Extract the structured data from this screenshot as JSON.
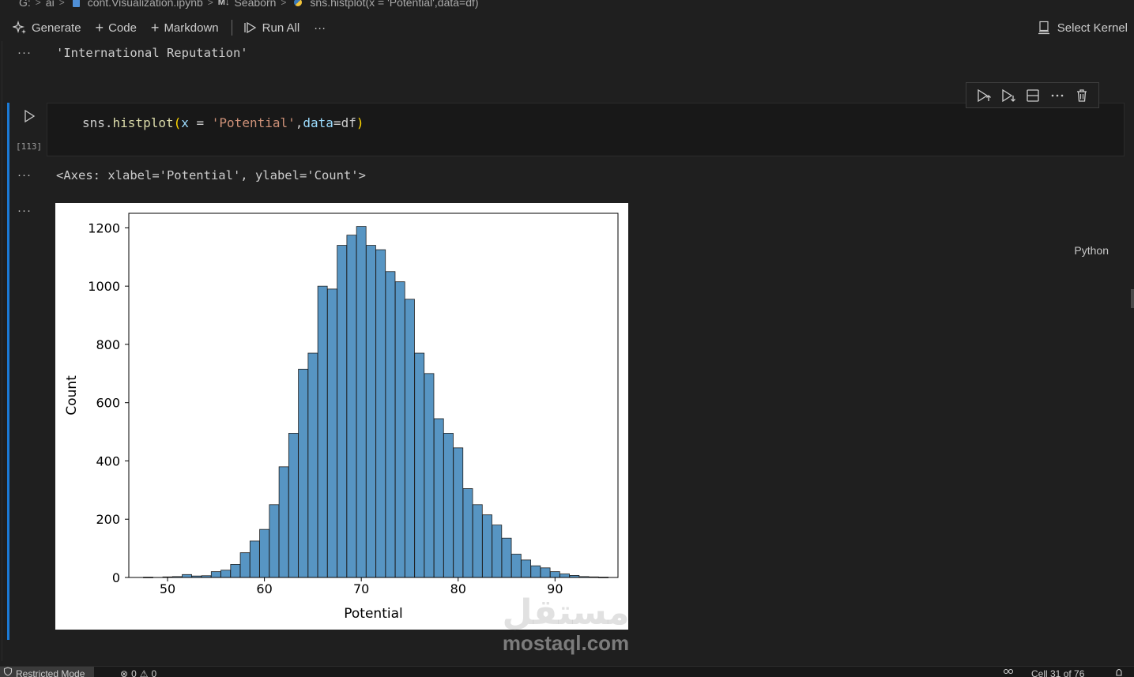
{
  "breadcrumb": {
    "items": [
      "G:",
      "ai",
      "cont.Visualization.ipynb",
      "M↓",
      "Seaborn",
      "sns.histplot(x = 'Potential',data=df)"
    ]
  },
  "toolbar": {
    "generate_label": "Generate",
    "code_label": "Code",
    "markdown_label": "Markdown",
    "run_all_label": "Run All",
    "more_label": "···",
    "kernel_label": "Select Kernel"
  },
  "outputs": {
    "dots": "···",
    "prev_output": "'International Reputation'",
    "axes_repr": "<Axes: xlabel='Potential', ylabel='Count'>"
  },
  "cell": {
    "code_tokens": [
      {
        "text": "sns.",
        "cls": "t-plain"
      },
      {
        "text": "histplot",
        "cls": "t-fn"
      },
      {
        "text": "(",
        "cls": "t-paren"
      },
      {
        "text": "x",
        "cls": "t-var"
      },
      {
        "text": " = ",
        "cls": "t-op"
      },
      {
        "text": "'Potential'",
        "cls": "t-str"
      },
      {
        "text": ",",
        "cls": "t-plain"
      },
      {
        "text": "data",
        "cls": "t-var"
      },
      {
        "text": "=",
        "cls": "t-op"
      },
      {
        "text": "df",
        "cls": "t-plain"
      },
      {
        "text": ")",
        "cls": "t-paren"
      }
    ],
    "execution_count": "[113]",
    "language": "Python"
  },
  "chart_data": {
    "type": "bar",
    "title": "",
    "xlabel": "Potential",
    "ylabel": "Count",
    "xlim": [
      46,
      96.5
    ],
    "ylim": [
      0,
      1250
    ],
    "xticks": [
      50,
      60,
      70,
      80,
      90
    ],
    "yticks": [
      0,
      200,
      400,
      600,
      800,
      1000,
      1200
    ],
    "bar_color": "#4e8fc0",
    "bin_width": 0.98,
    "bins": [
      {
        "x": 48.0,
        "count": 1
      },
      {
        "x": 49.0,
        "count": 0
      },
      {
        "x": 50.0,
        "count": 2
      },
      {
        "x": 51.0,
        "count": 3
      },
      {
        "x": 52.0,
        "count": 10
      },
      {
        "x": 53.0,
        "count": 5
      },
      {
        "x": 54.0,
        "count": 6
      },
      {
        "x": 55.0,
        "count": 20
      },
      {
        "x": 56.0,
        "count": 25
      },
      {
        "x": 57.0,
        "count": 45
      },
      {
        "x": 58.0,
        "count": 85
      },
      {
        "x": 59.0,
        "count": 125
      },
      {
        "x": 60.0,
        "count": 165
      },
      {
        "x": 61.0,
        "count": 250
      },
      {
        "x": 62.0,
        "count": 380
      },
      {
        "x": 63.0,
        "count": 495
      },
      {
        "x": 64.0,
        "count": 715
      },
      {
        "x": 65.0,
        "count": 770
      },
      {
        "x": 66.0,
        "count": 1000
      },
      {
        "x": 67.0,
        "count": 990
      },
      {
        "x": 68.0,
        "count": 1140
      },
      {
        "x": 69.0,
        "count": 1175
      },
      {
        "x": 70.0,
        "count": 1205
      },
      {
        "x": 71.0,
        "count": 1140
      },
      {
        "x": 72.0,
        "count": 1125
      },
      {
        "x": 73.0,
        "count": 1050
      },
      {
        "x": 74.0,
        "count": 1015
      },
      {
        "x": 75.0,
        "count": 955
      },
      {
        "x": 76.0,
        "count": 770
      },
      {
        "x": 77.0,
        "count": 700
      },
      {
        "x": 78.0,
        "count": 545
      },
      {
        "x": 79.0,
        "count": 495
      },
      {
        "x": 80.0,
        "count": 445
      },
      {
        "x": 81.0,
        "count": 305
      },
      {
        "x": 82.0,
        "count": 250
      },
      {
        "x": 83.0,
        "count": 215
      },
      {
        "x": 84.0,
        "count": 180
      },
      {
        "x": 85.0,
        "count": 135
      },
      {
        "x": 86.0,
        "count": 80
      },
      {
        "x": 87.0,
        "count": 60
      },
      {
        "x": 88.0,
        "count": 40
      },
      {
        "x": 89.0,
        "count": 33
      },
      {
        "x": 90.0,
        "count": 20
      },
      {
        "x": 91.0,
        "count": 12
      },
      {
        "x": 92.0,
        "count": 7
      },
      {
        "x": 93.0,
        "count": 3
      },
      {
        "x": 94.0,
        "count": 2
      },
      {
        "x": 95.0,
        "count": 1
      }
    ]
  },
  "watermark": {
    "logo_text": "مستقل",
    "site_text": "mostaql.com"
  },
  "statusbar": {
    "restricted_label": "Restricted Mode",
    "errors": "0",
    "warnings": "0",
    "cell_position": "Cell 31 of 76"
  },
  "colors": {
    "accent": "#1b7ad6",
    "background": "#1f1f1f",
    "cell_background": "#181818"
  }
}
